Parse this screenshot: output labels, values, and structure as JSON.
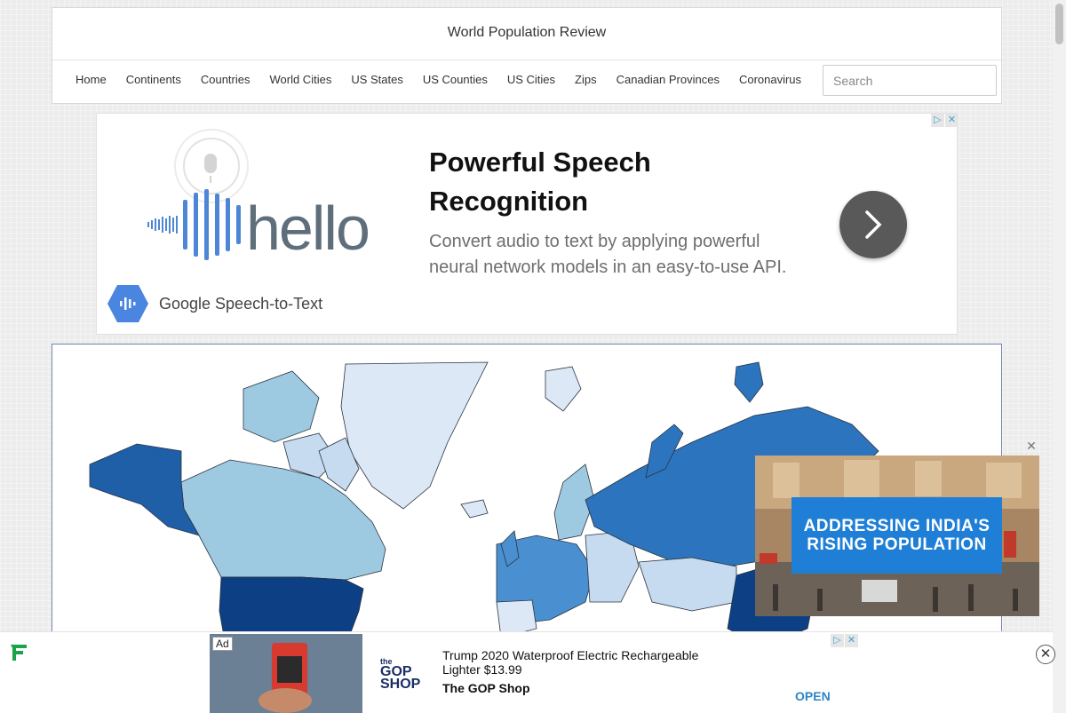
{
  "header": {
    "site_title": "World Population Review",
    "nav": [
      "Home",
      "Continents",
      "Countries",
      "World Cities",
      "US States",
      "US Counties",
      "US Cities",
      "Zips",
      "Canadian Provinces",
      "Coronavirus"
    ],
    "search_placeholder": "Search"
  },
  "top_ad": {
    "wordmark": "hello",
    "product_label": "Google Speech-to-Text",
    "headline": "Powerful Speech Recognition",
    "description": "Convert audio to text by applying powerful neural network models in an easy-to-use API.",
    "adchoices": [
      "▷",
      "✕"
    ]
  },
  "video": {
    "banner_line1": "ADDRESSING INDIA'S",
    "banner_line2": "RISING POPULATION",
    "close": "✕"
  },
  "bottom_ad": {
    "ad_label": "Ad",
    "logo_small": "the",
    "logo_big": "GOP SHOP",
    "title": "Trump 2020 Waterproof Electric Rechargeable Lighter $13.99",
    "advertiser": "The GOP Shop",
    "cta": "OPEN",
    "close": "✕",
    "adchoices": [
      "▷",
      "✕"
    ]
  },
  "colors": {
    "map_light": "#dce8f5",
    "map_pale": "#c6dbef",
    "map_mid": "#9ecae1",
    "map_blue": "#4a90d0",
    "map_dark": "#1f5fa8",
    "map_darkest": "#0d3f84",
    "banner_blue": "#1f7fd6",
    "open_blue": "#2c86c7"
  }
}
